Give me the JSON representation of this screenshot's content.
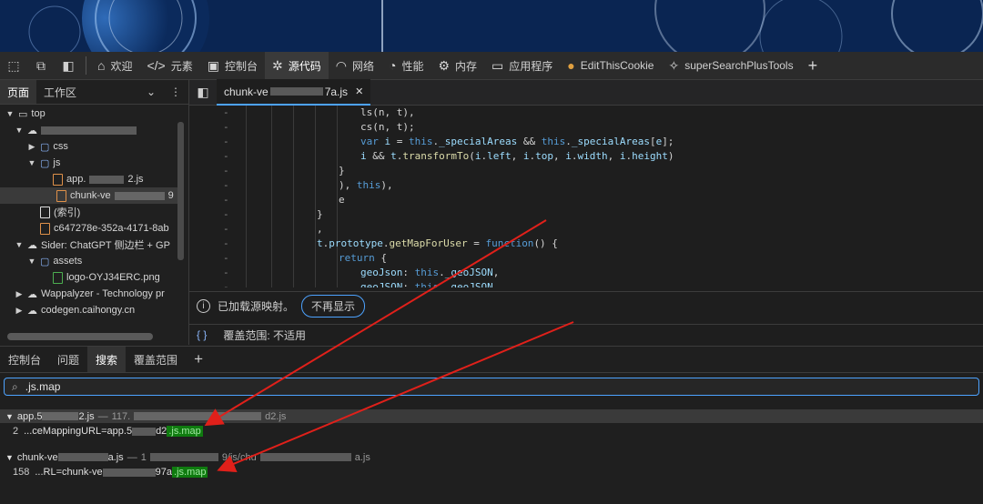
{
  "topbar": {
    "tabs": [
      {
        "icon": "home-icon",
        "label": "欢迎"
      },
      {
        "icon": "code-icon",
        "label": "元素"
      },
      {
        "icon": "terminal-icon",
        "label": "控制台"
      },
      {
        "icon": "bug-icon",
        "label": "源代码"
      },
      {
        "icon": "wifi-icon",
        "label": "网络"
      },
      {
        "icon": "gauge-icon",
        "label": "性能"
      },
      {
        "icon": "gear-icon",
        "label": "内存"
      },
      {
        "icon": "window-icon",
        "label": "应用程序"
      },
      {
        "icon": "cookie-icon",
        "label": "EditThisCookie"
      },
      {
        "icon": "puzzle-icon",
        "label": "superSearchPlusTools"
      }
    ],
    "add": "+"
  },
  "left": {
    "tabs": [
      "页面",
      "工作区"
    ],
    "chevron": "⌄",
    "more": "⋮",
    "tree": [
      {
        "label": "top"
      },
      {
        "label": ""
      },
      {
        "label": "css"
      },
      {
        "label": "js"
      },
      {
        "label": "app.",
        "suffix": "2.js"
      },
      {
        "label": "chunk-ve",
        "suffix": "9"
      },
      {
        "label": "(索引)"
      },
      {
        "label": "c647278e-352a-4171-8ab"
      },
      {
        "label": "Sider: ChatGPT 侧边栏 + GP"
      },
      {
        "label": "assets"
      },
      {
        "label": "logo-OYJ34ERC.png"
      },
      {
        "label": "Wappalyzer - Technology pr"
      },
      {
        "label": "codegen.caihongy.cn"
      }
    ]
  },
  "editor": {
    "tab_label_prefix": "chunk-ve",
    "tab_label_suffix": "7a.js",
    "close": "✕",
    "info_text": "已加载源映射。",
    "dont_show": "不再显示",
    "coverage_braces": "{ }",
    "coverage_text": "覆盖范围: 不适用"
  },
  "code_lines": [
    "ls(n, t),",
    "cs(n, t);",
    "var i = this._specialAreas && this._specialAreas[e];",
    "i && t.transformTo(i.left, i.top, i.width, i.height)",
    "}",
    "), this),",
    "e",
    "}",
    ",",
    "t.prototype.getMapForUser = function() {",
    "return {",
    "geoJson: this._geoJSON,",
    "geoJSON: this._geoJSON,"
  ],
  "drawer": {
    "tabs": [
      "控制台",
      "问题",
      "搜索",
      "覆盖范围"
    ],
    "add": "+",
    "search_value": ".js.map",
    "results": [
      {
        "file_prefix": "app.5",
        "file_suffix": "2.js",
        "sep": "—",
        "path_prefix": "117.",
        "path_suffix": "d2.js",
        "line": "2",
        "text": "...ceMappingURL=app.5",
        "text_tail": "d2",
        "match": ".js.map"
      },
      {
        "file_prefix": "chunk-ve",
        "file_suffix": "a.js",
        "sep": "—",
        "path_prefix": "1",
        "path_mid": "9/js/chu",
        "path_suffix": "a.js",
        "line": "158",
        "text": "...RL=chunk-ve",
        "text_tail": "97a",
        "match": ".js.map"
      }
    ]
  }
}
